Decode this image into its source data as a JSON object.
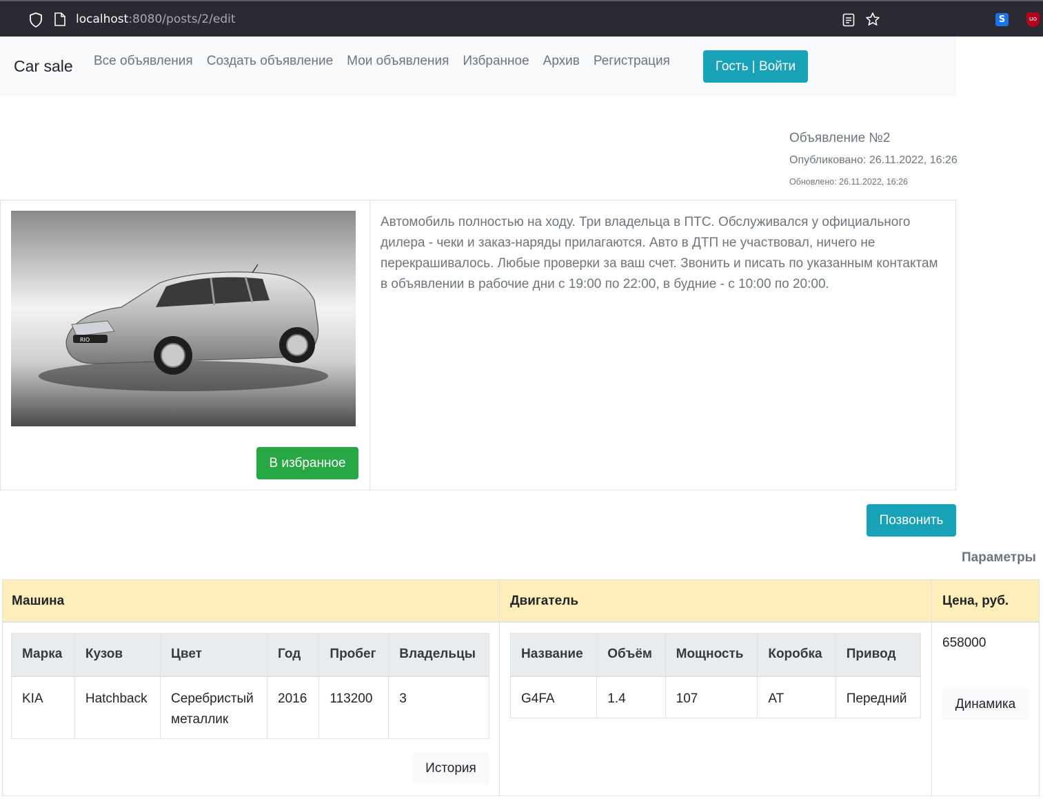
{
  "browser": {
    "url_host": "localhost",
    "url_rest": ":8080/posts/2/edit"
  },
  "navbar": {
    "brand": "Car sale",
    "links": [
      "Все объявления",
      "Создать объявление",
      "Мои объявления",
      "Избранное",
      "Архив",
      "Регистрация"
    ],
    "login_button": "Гость | Войти"
  },
  "post": {
    "title": "Объявление №2",
    "published": "Опубликовано: 26.11.2022, 16:26",
    "updated": "Обновлено: 26.11.2022, 16:26",
    "image_alt": "Kia Rio hatchback, silver",
    "favorite_button": "В избранное",
    "description": "Автомобиль полностью на ходу. Три владельца в ПТС. Обслуживался у официального дилера - чеки и заказ-наряды прилагаются. Авто в ДТП не участвовал, ничего не перекрашивалось. Любые проверки за ваш счет. Звонить и писать по указанным контактам в объявлении в рабочие дни с 19:00 по 22:00, в будние - с 10:00 по 20:00.",
    "call_button": "Позвонить"
  },
  "params": {
    "caption": "Параметры",
    "headers": {
      "car": "Машина",
      "engine": "Двигатель",
      "price": "Цена, руб."
    },
    "car": {
      "columns": [
        "Марка",
        "Кузов",
        "Цвет",
        "Год",
        "Пробег",
        "Владельцы"
      ],
      "row": [
        "KIA",
        "Hatchback",
        "Серебристый металлик",
        "2016",
        "113200",
        "3"
      ]
    },
    "engine": {
      "columns": [
        "Название",
        "Объём",
        "Мощность",
        "Коробка",
        "Привод"
      ],
      "row": [
        "G4FA",
        "1.4",
        "107",
        "AT",
        "Передний"
      ]
    },
    "price": "658000",
    "history_button": "История",
    "dynamics_button": "Динамика"
  },
  "colors": {
    "info": "#17a2b8",
    "success": "#28a745",
    "warning_light": "#ffeeba",
    "navbar_bg": "#f8f9fa"
  }
}
